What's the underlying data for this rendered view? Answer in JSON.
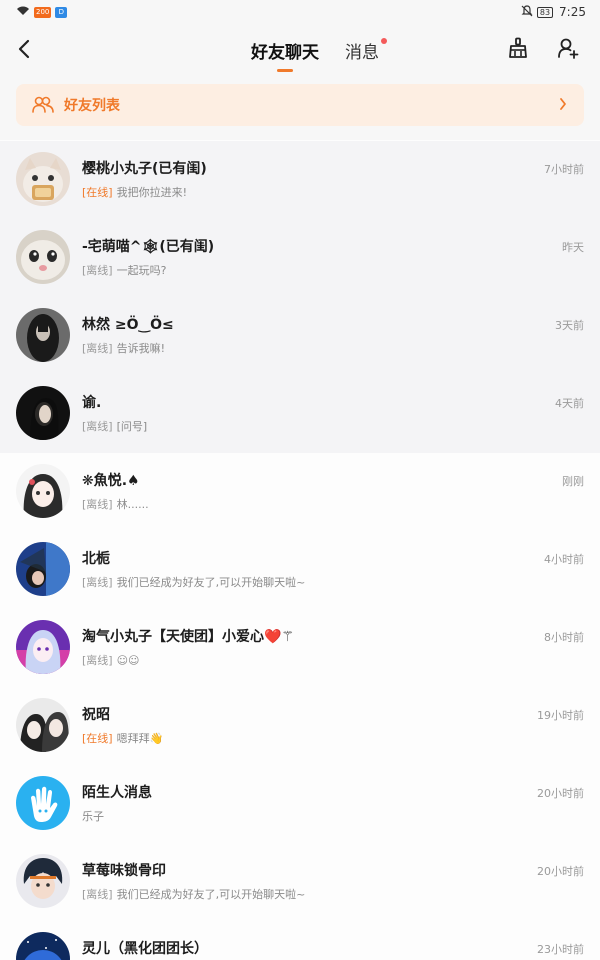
{
  "status_bar": {
    "badge1": "200",
    "badge2": "D",
    "battery": "83",
    "time": "7:25"
  },
  "header": {
    "tabs": [
      {
        "label": "好友聊天",
        "active": true
      },
      {
        "label": "消息",
        "active": false,
        "has_dot": true
      }
    ]
  },
  "friends_banner": {
    "label": "好友列表"
  },
  "colors": {
    "accent": "#f07a2b",
    "banner_bg": "#fdeee2",
    "unread_dot": "#f45a5a"
  },
  "conversations": [
    {
      "name": "樱桃小丸子(已有闺)",
      "status": "[在线]",
      "online": true,
      "message": "我把你拉进来!",
      "time": "7小时前",
      "avatar": "cat-toast-avatar",
      "highlighted": true
    },
    {
      "name": "-宅萌喵^🕸(已有闺)",
      "status": "[离线]",
      "online": false,
      "message": "一起玩吗?",
      "time": "昨天",
      "avatar": "cat-face-avatar",
      "highlighted": true
    },
    {
      "name": "林然 ≥Ö‿Ö≤",
      "status": "[离线]",
      "online": false,
      "message": "告诉我嘛!",
      "time": "3天前",
      "avatar": "dark-hair-avatar",
      "highlighted": true
    },
    {
      "name": "谕.",
      "status": "[离线]",
      "online": false,
      "message": "[问号]",
      "time": "4天前",
      "avatar": "dark-portrait-avatar",
      "highlighted": true
    },
    {
      "name": "❋魚悦.♠",
      "status": "[离线]",
      "online": false,
      "message": "林......",
      "time": "刚刚",
      "avatar": "anime-girl-avatar",
      "highlighted": false
    },
    {
      "name": "北栀",
      "status": "[离线]",
      "online": false,
      "message": "我们已经成为好友了,可以开始聊天啦~",
      "time": "4小时前",
      "avatar": "blue-umbrella-avatar",
      "highlighted": false
    },
    {
      "name": "淘气小丸子【天使团】小爱心❤️⚚",
      "status": "[离线]",
      "online": false,
      "message": "☺☺",
      "time": "8小时前",
      "avatar": "purple-anime-avatar",
      "highlighted": false
    },
    {
      "name": "祝昭",
      "status": "[在线]",
      "online": true,
      "message": "嗯拜拜👋",
      "time": "19小时前",
      "avatar": "anime-pair-avatar",
      "highlighted": false
    },
    {
      "name": "陌生人消息",
      "status": "",
      "online": false,
      "message": "乐子",
      "time": "20小时前",
      "avatar": "stranger-hand-avatar",
      "highlighted": false
    },
    {
      "name": "草莓味锁骨印",
      "status": "[离线]",
      "online": false,
      "message": "我们已经成为好友了,可以开始聊天啦~",
      "time": "20小时前",
      "avatar": "anime-boy-avatar",
      "highlighted": false
    },
    {
      "name": "灵儿（黑化团团长）",
      "status": "",
      "online": false,
      "message": "",
      "time": "23小时前",
      "avatar": "night-sky-avatar",
      "highlighted": false
    }
  ]
}
